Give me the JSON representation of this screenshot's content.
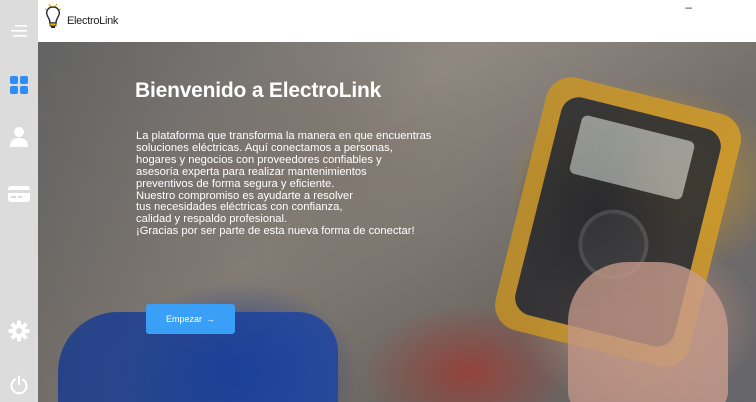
{
  "app": {
    "logo_text": "ElectroLink"
  },
  "window": {
    "minimize_label": "–"
  },
  "sidebar": {
    "items": [
      {
        "icon": "menu-icon"
      },
      {
        "icon": "dashboard-grid-icon"
      },
      {
        "icon": "user-icon"
      },
      {
        "icon": "credit-card-icon"
      },
      {
        "icon": "gear-icon"
      },
      {
        "icon": "power-icon"
      }
    ],
    "active_color": "#2f8cf5",
    "icon_color": "#ffffff"
  },
  "hero": {
    "title": "Bienvenido a ElectroLink",
    "lines": [
      "La plataforma que transforma la manera en que encuentras",
      "soluciones eléctricas. Aquí conectamos a personas,",
      "hogares y negocios con proveedores confiables y",
      "asesoría experta para realizar mantenimientos",
      "preventivos de forma segura y eficiente.",
      "Nuestro compromiso es ayudarte a resolver",
      "tus necesidades eléctricas con confianza,",
      "calidad y respaldo profesional.",
      "¡Gracias por ser parte de esta nueva forma de conectar!"
    ],
    "cta_label": "Empezar",
    "cta_arrow": "→",
    "cta_color": "#3aa0f7"
  }
}
